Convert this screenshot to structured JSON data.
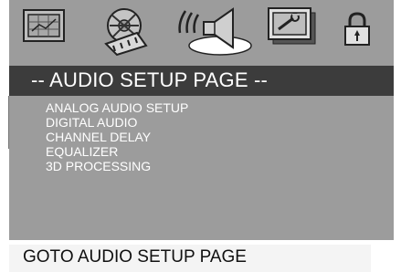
{
  "icons": [
    "general-setup-icon",
    "video-setup-icon",
    "audio-setup-icon",
    "preference-icon",
    "lock-icon"
  ],
  "header": {
    "title": "-- AUDIO SETUP PAGE --"
  },
  "menu": {
    "items": [
      {
        "label": "ANALOG AUDIO SETUP"
      },
      {
        "label": "DIGITAL AUDIO"
      },
      {
        "label": "CHANNEL DELAY"
      },
      {
        "label": "EQUALIZER"
      },
      {
        "label": "3D PROCESSING"
      }
    ]
  },
  "status": {
    "text": "GOTO AUDIO SETUP PAGE"
  },
  "colors": {
    "panel": "#9c9c9c",
    "title_bar": "#3c3c3c",
    "status_bar": "#f4f4f4",
    "text_light": "#ffffff"
  }
}
